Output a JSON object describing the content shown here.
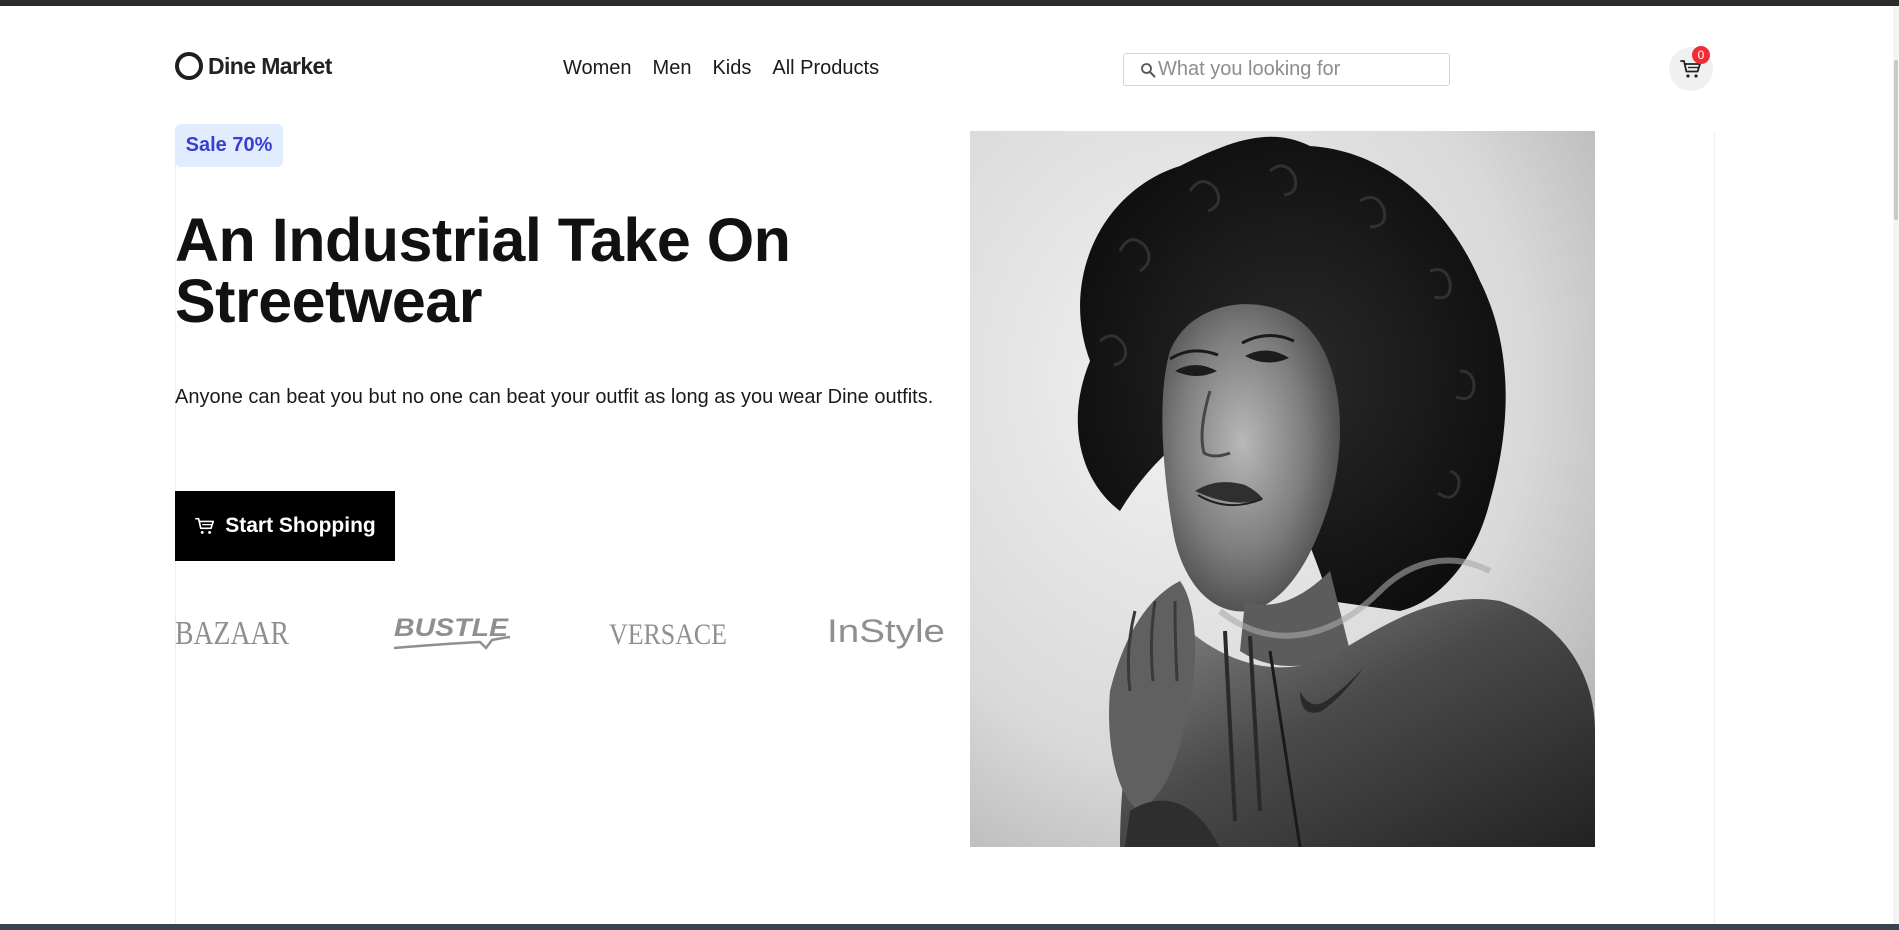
{
  "header": {
    "logo_text": "Dine Market",
    "nav": [
      "Women",
      "Men",
      "Kids",
      "All Products"
    ],
    "search_placeholder": "What you looking for",
    "cart_count": "0"
  },
  "hero": {
    "sale_badge": "Sale 70%",
    "title": "An Industrial Take On Streetwear",
    "description": "Anyone can beat you but no one can beat your outfit as long as you wear Dine outfits.",
    "cta_label": "Start Shopping"
  },
  "brands": [
    "BAZAAR",
    "BUSTLE",
    "VERSACE",
    "InStyle"
  ],
  "colors": {
    "accent_black": "#000000",
    "sale_bg": "#e1edff",
    "sale_text": "#3a3fcf",
    "cart_badge": "#f02d34"
  },
  "icons": {
    "search": "search-icon",
    "cart": "cart-icon",
    "cta": "cart-icon"
  }
}
